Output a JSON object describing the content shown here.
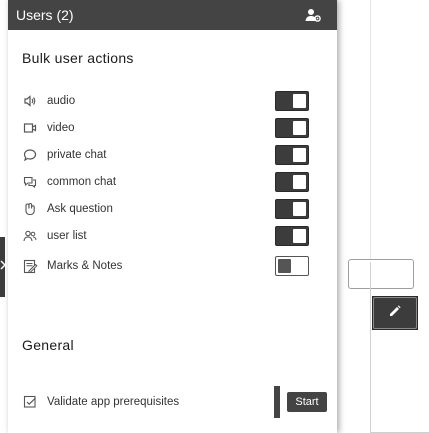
{
  "panel": {
    "header": {
      "title": "Users (2)",
      "icon": "users-gear-icon"
    },
    "bulk_section": {
      "title": "Bulk user actions",
      "actions": [
        {
          "label": "audio",
          "icon": "audio-icon",
          "enabled": true
        },
        {
          "label": "video",
          "icon": "video-icon",
          "enabled": true
        },
        {
          "label": "private chat",
          "icon": "private-chat-icon",
          "enabled": true
        },
        {
          "label": "common chat",
          "icon": "common-chat-icon",
          "enabled": true
        },
        {
          "label": "Ask question",
          "icon": "ask-question-icon",
          "enabled": true
        },
        {
          "label": "user list",
          "icon": "user-list-icon",
          "enabled": true
        },
        {
          "label": "Marks & Notes",
          "icon": "marks-notes-icon",
          "enabled": false
        }
      ]
    },
    "general_section": {
      "title": "General",
      "actions": [
        {
          "label": "Validate app prerequisites",
          "icon": "checklist-icon",
          "button_label": "Start"
        }
      ]
    }
  },
  "background": {
    "edit_icon": "edit-icon",
    "chevron_icon": "chevron-right-icon"
  },
  "colors": {
    "header_bg": "#444444",
    "toggle_on": "#3c3c3c",
    "text": "#333333"
  }
}
